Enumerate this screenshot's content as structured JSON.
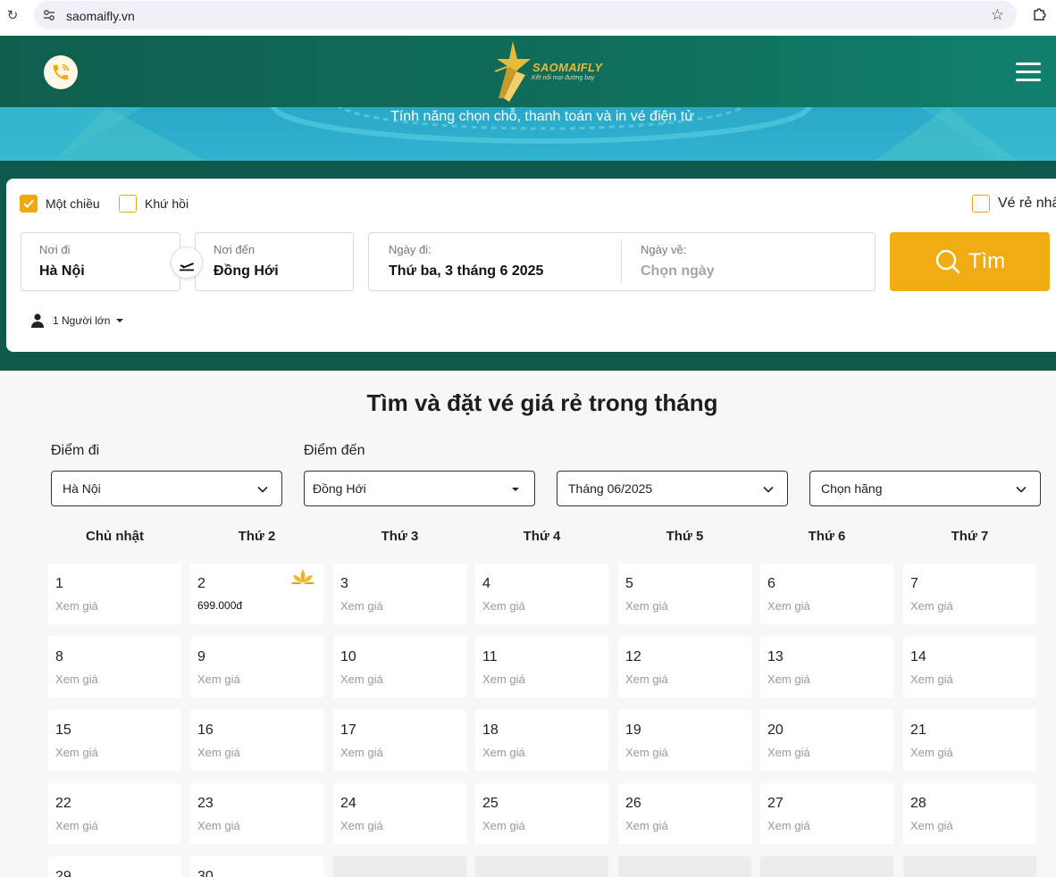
{
  "browser": {
    "url": "saomaifly.vn"
  },
  "header": {
    "brand": "SAOMAIFLY",
    "tagline": "Kết nối mọi đường bay"
  },
  "hero": {
    "text": "Tính năng chọn chỗ, thanh toán và in vé điện tử"
  },
  "search": {
    "one_way_label": "Một chiều",
    "round_trip_label": "Khứ hồi",
    "cheapest_label": "Vé rẻ nhất",
    "from_label": "Nơi đi",
    "from_value": "Hà Nội",
    "to_label": "Nơi đến",
    "to_value": "Đồng Hới",
    "depart_label": "Ngày đi:",
    "depart_value": "Thứ ba, 3 tháng 6 2025",
    "return_label": "Ngày về:",
    "return_value": "Chọn ngày",
    "search_button": "Tìm",
    "passengers": "1 Người lớn",
    "accent_color": "#f0ac12"
  },
  "calendar": {
    "title": "Tìm và đặt vé giá rẻ trong tháng",
    "origin_label": "Điểm đi",
    "origin_value": "Hà Nội",
    "destination_label": "Điểm đến",
    "destination_value": "Đồng Hới",
    "month_value": "Tháng 06/2025",
    "airline_value": "Chọn hãng",
    "weekdays": [
      "Chủ nhật",
      "Thứ 2",
      "Thứ 3",
      "Thứ 4",
      "Thứ 5",
      "Thứ 6",
      "Thứ 7"
    ],
    "days": [
      {
        "num": "1",
        "sub": "Xem giá"
      },
      {
        "num": "2",
        "sub": "699.000đ",
        "deal": true
      },
      {
        "num": "3",
        "sub": "Xem giá"
      },
      {
        "num": "4",
        "sub": "Xem giá"
      },
      {
        "num": "5",
        "sub": "Xem giá"
      },
      {
        "num": "6",
        "sub": "Xem giá"
      },
      {
        "num": "7",
        "sub": "Xem giá"
      },
      {
        "num": "8",
        "sub": "Xem giá"
      },
      {
        "num": "9",
        "sub": "Xem giá"
      },
      {
        "num": "10",
        "sub": "Xem giá"
      },
      {
        "num": "11",
        "sub": "Xem giá"
      },
      {
        "num": "12",
        "sub": "Xem giá"
      },
      {
        "num": "13",
        "sub": "Xem giá"
      },
      {
        "num": "14",
        "sub": "Xem giá"
      },
      {
        "num": "15",
        "sub": "Xem giá"
      },
      {
        "num": "16",
        "sub": "Xem giá"
      },
      {
        "num": "17",
        "sub": "Xem giá"
      },
      {
        "num": "18",
        "sub": "Xem giá"
      },
      {
        "num": "19",
        "sub": "Xem giá"
      },
      {
        "num": "20",
        "sub": "Xem giá"
      },
      {
        "num": "21",
        "sub": "Xem giá"
      },
      {
        "num": "22",
        "sub": "Xem giá"
      },
      {
        "num": "23",
        "sub": "Xem giá"
      },
      {
        "num": "24",
        "sub": "Xem giá"
      },
      {
        "num": "25",
        "sub": "Xem giá"
      },
      {
        "num": "26",
        "sub": "Xem giá"
      },
      {
        "num": "27",
        "sub": "Xem giá"
      },
      {
        "num": "28",
        "sub": "Xem giá"
      },
      {
        "num": "29",
        "sub": ""
      },
      {
        "num": "30",
        "sub": ""
      }
    ]
  }
}
